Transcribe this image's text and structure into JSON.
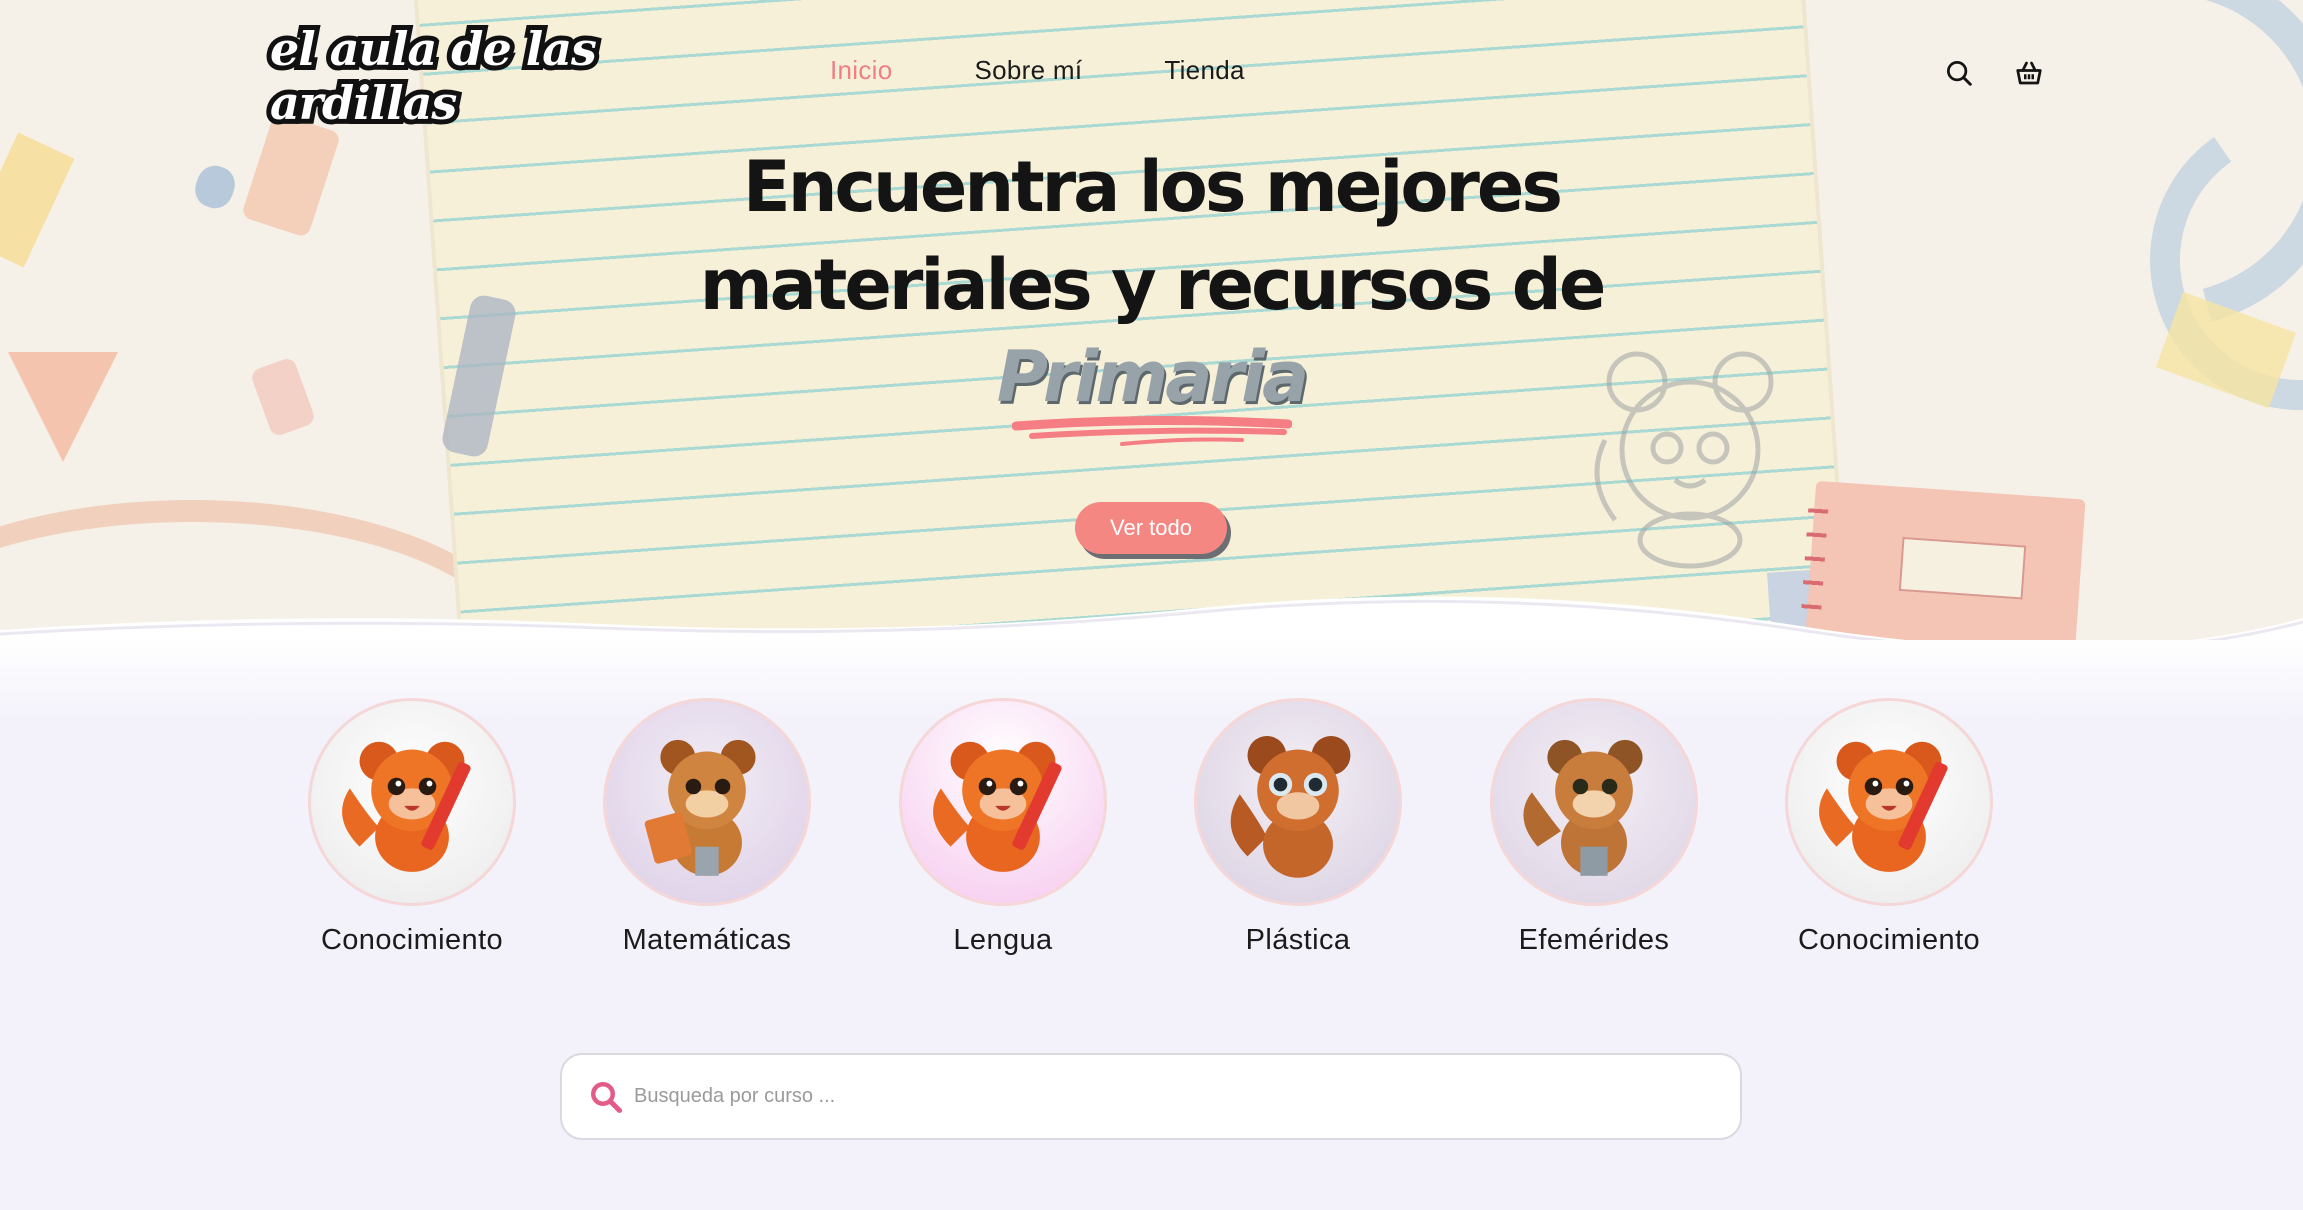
{
  "brand": {
    "logo_text": "el aula de las ardillas"
  },
  "nav": {
    "items": [
      {
        "label": "Inicio",
        "active": true
      },
      {
        "label": "Sobre mí",
        "active": false
      },
      {
        "label": "Tienda",
        "active": false
      }
    ],
    "icons": [
      "search-icon",
      "basket-icon"
    ]
  },
  "hero": {
    "line1": "Encuentra los mejores",
    "line2": "materiales y recursos de",
    "highlight": "Primaria",
    "cta_label": "Ver todo"
  },
  "categories": [
    {
      "label": "Conocimiento",
      "bg": "#f3f3f3"
    },
    {
      "label": "Matemáticas",
      "bg": "#e3daea"
    },
    {
      "label": "Lengua",
      "bg": "#f6d3ef"
    },
    {
      "label": "Plástica",
      "bg": "#e2dbe8"
    },
    {
      "label": "Efemérides",
      "bg": "#e6dfe9"
    },
    {
      "label": "Conocimiento",
      "bg": "#f3f3f3"
    }
  ],
  "search": {
    "placeholder": "Busqueda por curso ..."
  },
  "colors": {
    "accent": "#ee7f83",
    "cta": "#f58783",
    "search_icon": "#e25c87"
  }
}
